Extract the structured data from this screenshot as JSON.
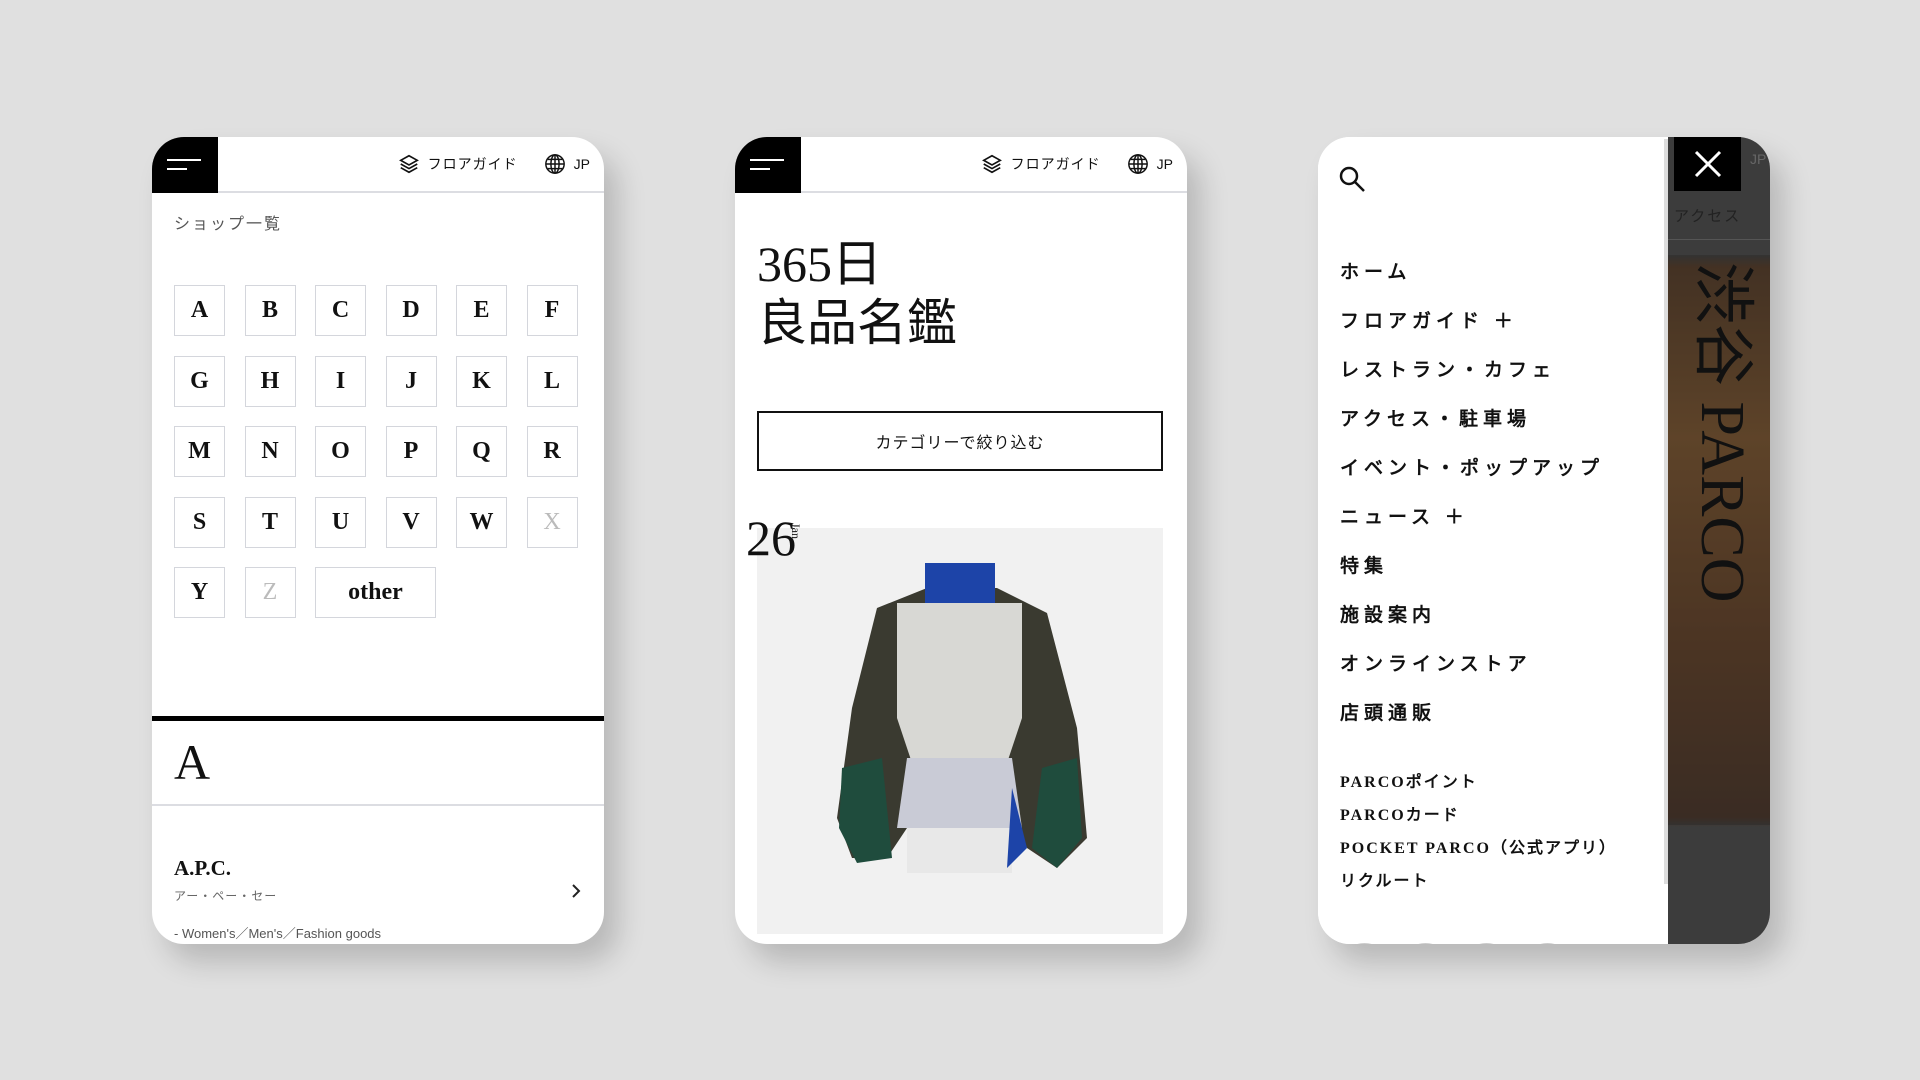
{
  "header": {
    "floor_guide": "フロアガイド",
    "lang": "JP"
  },
  "panel1": {
    "title": "ショップ一覧",
    "letters": [
      {
        "l": "A",
        "enabled": true
      },
      {
        "l": "B",
        "enabled": true
      },
      {
        "l": "C",
        "enabled": true
      },
      {
        "l": "D",
        "enabled": true
      },
      {
        "l": "E",
        "enabled": true
      },
      {
        "l": "F",
        "enabled": true
      },
      {
        "l": "G",
        "enabled": true
      },
      {
        "l": "H",
        "enabled": true
      },
      {
        "l": "I",
        "enabled": true
      },
      {
        "l": "J",
        "enabled": true
      },
      {
        "l": "K",
        "enabled": true
      },
      {
        "l": "L",
        "enabled": true
      },
      {
        "l": "M",
        "enabled": true
      },
      {
        "l": "N",
        "enabled": true
      },
      {
        "l": "O",
        "enabled": true
      },
      {
        "l": "P",
        "enabled": true
      },
      {
        "l": "Q",
        "enabled": true
      },
      {
        "l": "R",
        "enabled": true
      },
      {
        "l": "S",
        "enabled": true
      },
      {
        "l": "T",
        "enabled": true
      },
      {
        "l": "U",
        "enabled": true
      },
      {
        "l": "V",
        "enabled": true
      },
      {
        "l": "W",
        "enabled": true
      },
      {
        "l": "X",
        "enabled": false
      },
      {
        "l": "Y",
        "enabled": true
      },
      {
        "l": "Z",
        "enabled": false
      },
      {
        "l": "other",
        "enabled": true
      }
    ],
    "section_letter": "A",
    "shop": {
      "name": "A.P.C.",
      "kana": "アー・ペー・セー",
      "category": "- Women's／Men's／Fashion goods"
    }
  },
  "panel2": {
    "title_line1": "365日",
    "title_line2": "良品名鑑",
    "filter_button": "カテゴリーで絞り込む",
    "date_day": "26",
    "date_month": "Jan"
  },
  "panel3": {
    "menu": [
      "ホーム",
      "フロアガイド ＋",
      "レストラン・カフェ",
      "アクセス・駐車場",
      "イベント・ポップアップ",
      "ニュース ＋",
      "特集",
      "施設案内",
      "オンラインストア",
      "店頭通販"
    ],
    "sub_menu": [
      "PARCOポイント",
      "PARCOカード",
      "POCKET PARCO（公式アプリ）",
      "リクルート"
    ],
    "social_icons": [
      "instagram-icon",
      "line-icon",
      "twitter-icon",
      "facebook-icon"
    ],
    "bg_access": "アクセス",
    "bg_jp": "JP",
    "logo_text": "渋谷 PARCO"
  }
}
